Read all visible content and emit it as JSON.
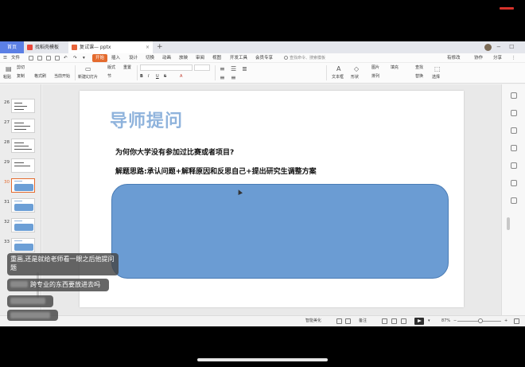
{
  "tabs": {
    "home": "首页",
    "templates": "找稻壳模板",
    "document": "复试课— pptx",
    "close_glyph": "×",
    "add_glyph": "+"
  },
  "menu": {
    "file": "文件",
    "active": "开始",
    "items": [
      "插入",
      "设计",
      "切换",
      "动画",
      "放映",
      "审阅",
      "视图",
      "开发工具",
      "会员专享"
    ],
    "search": "查找命令、搜索模板",
    "right_items": [
      "有修改",
      "协作",
      "分享"
    ]
  },
  "ribbon": {
    "labels": {
      "paste": "粘贴",
      "cut": "剪切",
      "copy": "复制",
      "format_painter": "格式刷",
      "from_current": "当前开始",
      "new_slide": "新建幻灯片",
      "layout": "版式",
      "section": "节",
      "reset": "重置",
      "text_box": "文本框",
      "shape": "形状",
      "arrange": "排列",
      "picture": "图片",
      "fill": "填充",
      "find": "查找",
      "replace": "替换",
      "select": "选择"
    },
    "glyphs": {
      "bold": "B",
      "italic": "I",
      "underline": "U",
      "strike": "S",
      "font_color": "A"
    }
  },
  "slide_panel": {
    "slides": [
      {
        "number": "26",
        "selected": false
      },
      {
        "number": "27",
        "selected": false
      },
      {
        "number": "28",
        "selected": false
      },
      {
        "number": "29",
        "selected": false
      },
      {
        "number": "30",
        "selected": true
      },
      {
        "number": "31",
        "selected": false
      },
      {
        "number": "32",
        "selected": false
      },
      {
        "number": "33",
        "selected": false
      }
    ]
  },
  "slide": {
    "title": "导师提问",
    "question": "为何你大学没有参加过比赛或者项目?",
    "answer": "解题思路:承认问题+解释原因和反思自己+提出研究生调整方案",
    "box_color": "#6b9cd3",
    "title_color": "#8fb3dc"
  },
  "status": {
    "smart_beautify": "智能美化",
    "notes": "备注",
    "zoom": "87%"
  },
  "comments": {
    "c1": "重画,还是就给老师看一眼之后他提问题",
    "c2": "跨专业的东西要放进去吗"
  },
  "colors": {
    "accent": "#e46b2e",
    "home_tab": "#5b7fe5"
  },
  "icons": [
    "menu-icon",
    "save-icon",
    "undo-icon",
    "redo-icon",
    "search-icon",
    "play-icon",
    "zoom-out-icon",
    "zoom-in-icon",
    "fit-icon"
  ]
}
